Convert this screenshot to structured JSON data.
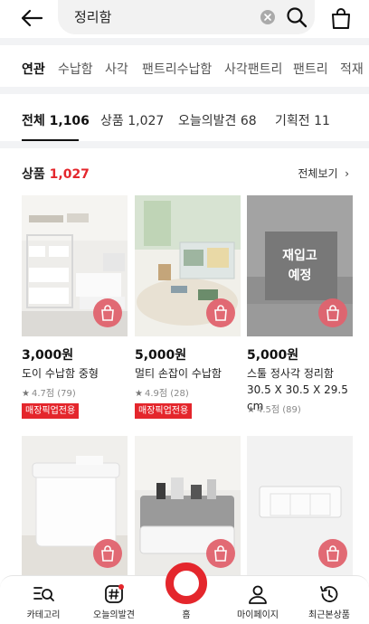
{
  "header": {
    "search_value": "정리함"
  },
  "related": {
    "label": "연관",
    "keywords": [
      "수납함",
      "사각",
      "팬트리수납함",
      "사각팬트리",
      "팬트리",
      "적재"
    ]
  },
  "tabs": [
    {
      "label": "전체 1,106",
      "active": true
    },
    {
      "label": "상품 1,027",
      "active": false
    },
    {
      "label": "오늘의발견 68",
      "active": false
    },
    {
      "label": "기획전 11",
      "active": false
    }
  ],
  "section": {
    "title": "상품",
    "count": "1,027",
    "view_all": "전체보기"
  },
  "products": [
    {
      "price": "3,000원",
      "name": "도이 수납함 중형",
      "rating": "4.7점 (79)",
      "badge": "매장픽업전용"
    },
    {
      "price": "5,000원",
      "name": "멀티 손잡이 수납함",
      "rating": "4.9점 (28)",
      "badge": "매장픽업전용"
    },
    {
      "price": "5,000원",
      "name": "스툴 정사각 정리함 30.5 X 30.5 X 29.5 cm",
      "rating": "4.5점 (89)",
      "overlay": "재입고\n예정"
    }
  ],
  "bottom_nav": {
    "items": [
      "카테고리",
      "오늘의발견",
      "홈",
      "마이페이지",
      "최근본상품"
    ]
  },
  "colors": {
    "accent": "#e4262c",
    "cart_button": "#e1636e"
  }
}
